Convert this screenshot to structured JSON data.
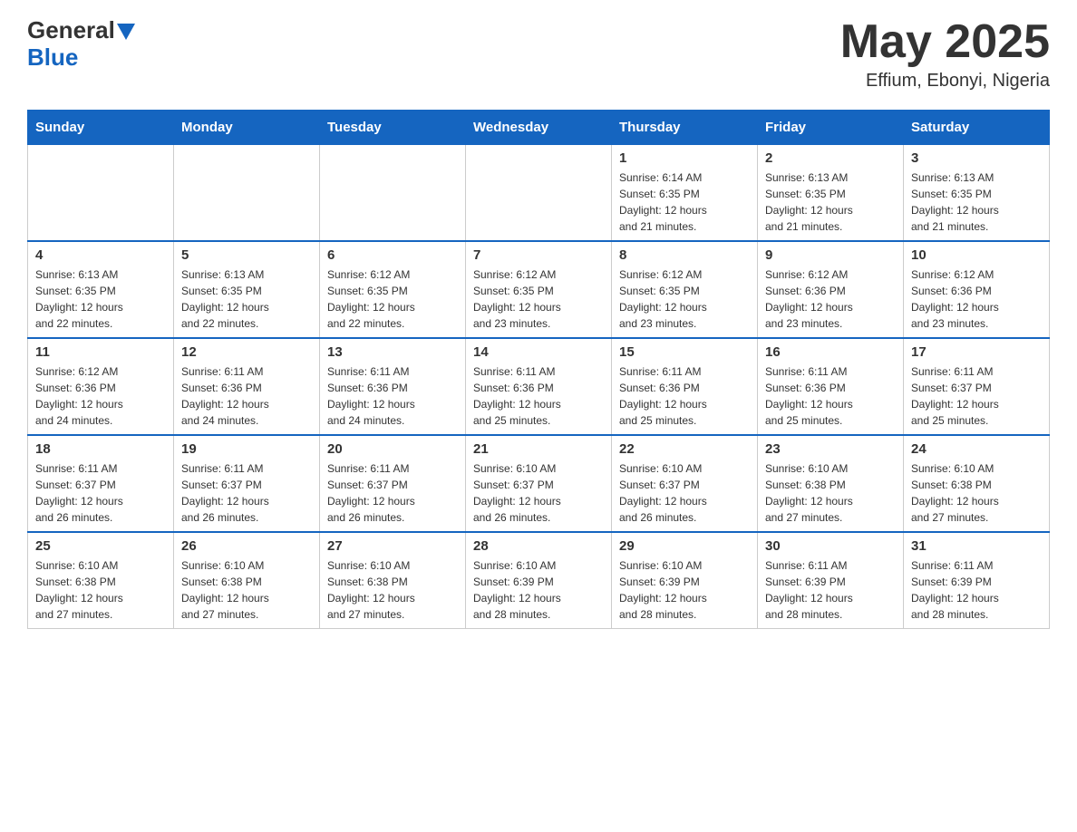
{
  "header": {
    "logo_general": "General",
    "logo_blue": "Blue",
    "month_year": "May 2025",
    "location": "Effium, Ebonyi, Nigeria"
  },
  "days_of_week": [
    "Sunday",
    "Monday",
    "Tuesday",
    "Wednesday",
    "Thursday",
    "Friday",
    "Saturday"
  ],
  "weeks": [
    [
      {
        "day": "",
        "info": ""
      },
      {
        "day": "",
        "info": ""
      },
      {
        "day": "",
        "info": ""
      },
      {
        "day": "",
        "info": ""
      },
      {
        "day": "1",
        "info": "Sunrise: 6:14 AM\nSunset: 6:35 PM\nDaylight: 12 hours\nand 21 minutes."
      },
      {
        "day": "2",
        "info": "Sunrise: 6:13 AM\nSunset: 6:35 PM\nDaylight: 12 hours\nand 21 minutes."
      },
      {
        "day": "3",
        "info": "Sunrise: 6:13 AM\nSunset: 6:35 PM\nDaylight: 12 hours\nand 21 minutes."
      }
    ],
    [
      {
        "day": "4",
        "info": "Sunrise: 6:13 AM\nSunset: 6:35 PM\nDaylight: 12 hours\nand 22 minutes."
      },
      {
        "day": "5",
        "info": "Sunrise: 6:13 AM\nSunset: 6:35 PM\nDaylight: 12 hours\nand 22 minutes."
      },
      {
        "day": "6",
        "info": "Sunrise: 6:12 AM\nSunset: 6:35 PM\nDaylight: 12 hours\nand 22 minutes."
      },
      {
        "day": "7",
        "info": "Sunrise: 6:12 AM\nSunset: 6:35 PM\nDaylight: 12 hours\nand 23 minutes."
      },
      {
        "day": "8",
        "info": "Sunrise: 6:12 AM\nSunset: 6:35 PM\nDaylight: 12 hours\nand 23 minutes."
      },
      {
        "day": "9",
        "info": "Sunrise: 6:12 AM\nSunset: 6:36 PM\nDaylight: 12 hours\nand 23 minutes."
      },
      {
        "day": "10",
        "info": "Sunrise: 6:12 AM\nSunset: 6:36 PM\nDaylight: 12 hours\nand 23 minutes."
      }
    ],
    [
      {
        "day": "11",
        "info": "Sunrise: 6:12 AM\nSunset: 6:36 PM\nDaylight: 12 hours\nand 24 minutes."
      },
      {
        "day": "12",
        "info": "Sunrise: 6:11 AM\nSunset: 6:36 PM\nDaylight: 12 hours\nand 24 minutes."
      },
      {
        "day": "13",
        "info": "Sunrise: 6:11 AM\nSunset: 6:36 PM\nDaylight: 12 hours\nand 24 minutes."
      },
      {
        "day": "14",
        "info": "Sunrise: 6:11 AM\nSunset: 6:36 PM\nDaylight: 12 hours\nand 25 minutes."
      },
      {
        "day": "15",
        "info": "Sunrise: 6:11 AM\nSunset: 6:36 PM\nDaylight: 12 hours\nand 25 minutes."
      },
      {
        "day": "16",
        "info": "Sunrise: 6:11 AM\nSunset: 6:36 PM\nDaylight: 12 hours\nand 25 minutes."
      },
      {
        "day": "17",
        "info": "Sunrise: 6:11 AM\nSunset: 6:37 PM\nDaylight: 12 hours\nand 25 minutes."
      }
    ],
    [
      {
        "day": "18",
        "info": "Sunrise: 6:11 AM\nSunset: 6:37 PM\nDaylight: 12 hours\nand 26 minutes."
      },
      {
        "day": "19",
        "info": "Sunrise: 6:11 AM\nSunset: 6:37 PM\nDaylight: 12 hours\nand 26 minutes."
      },
      {
        "day": "20",
        "info": "Sunrise: 6:11 AM\nSunset: 6:37 PM\nDaylight: 12 hours\nand 26 minutes."
      },
      {
        "day": "21",
        "info": "Sunrise: 6:10 AM\nSunset: 6:37 PM\nDaylight: 12 hours\nand 26 minutes."
      },
      {
        "day": "22",
        "info": "Sunrise: 6:10 AM\nSunset: 6:37 PM\nDaylight: 12 hours\nand 26 minutes."
      },
      {
        "day": "23",
        "info": "Sunrise: 6:10 AM\nSunset: 6:38 PM\nDaylight: 12 hours\nand 27 minutes."
      },
      {
        "day": "24",
        "info": "Sunrise: 6:10 AM\nSunset: 6:38 PM\nDaylight: 12 hours\nand 27 minutes."
      }
    ],
    [
      {
        "day": "25",
        "info": "Sunrise: 6:10 AM\nSunset: 6:38 PM\nDaylight: 12 hours\nand 27 minutes."
      },
      {
        "day": "26",
        "info": "Sunrise: 6:10 AM\nSunset: 6:38 PM\nDaylight: 12 hours\nand 27 minutes."
      },
      {
        "day": "27",
        "info": "Sunrise: 6:10 AM\nSunset: 6:38 PM\nDaylight: 12 hours\nand 27 minutes."
      },
      {
        "day": "28",
        "info": "Sunrise: 6:10 AM\nSunset: 6:39 PM\nDaylight: 12 hours\nand 28 minutes."
      },
      {
        "day": "29",
        "info": "Sunrise: 6:10 AM\nSunset: 6:39 PM\nDaylight: 12 hours\nand 28 minutes."
      },
      {
        "day": "30",
        "info": "Sunrise: 6:11 AM\nSunset: 6:39 PM\nDaylight: 12 hours\nand 28 minutes."
      },
      {
        "day": "31",
        "info": "Sunrise: 6:11 AM\nSunset: 6:39 PM\nDaylight: 12 hours\nand 28 minutes."
      }
    ]
  ]
}
